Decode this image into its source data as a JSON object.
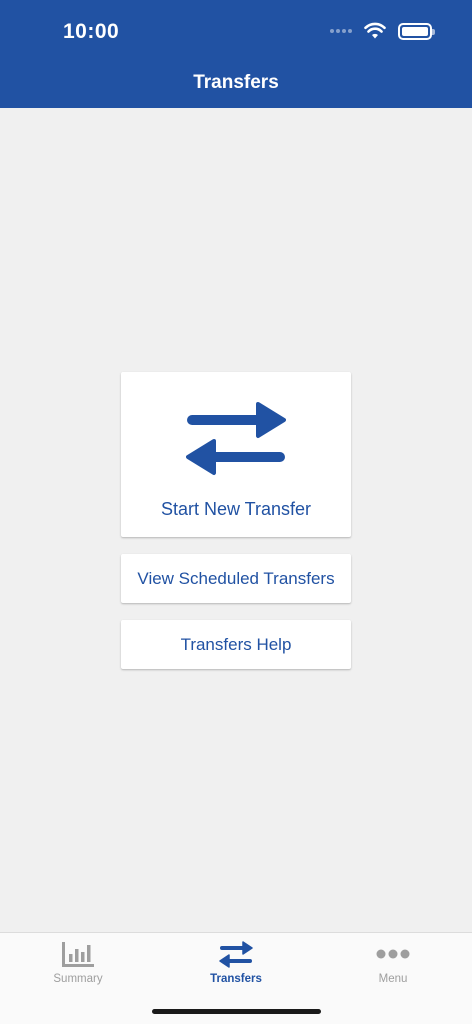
{
  "status_bar": {
    "time": "10:00"
  },
  "header": {
    "title": "Transfers"
  },
  "main": {
    "start_new_transfer": "Start New Transfer",
    "view_scheduled_transfers": "View Scheduled Transfers",
    "transfers_help": "Transfers Help"
  },
  "tabbar": {
    "tabs": [
      {
        "label": "Summary",
        "icon": "bar-chart-icon",
        "active": false
      },
      {
        "label": "Transfers",
        "icon": "transfer-arrows-icon",
        "active": true
      },
      {
        "label": "Menu",
        "icon": "more-dots-icon",
        "active": false
      }
    ]
  },
  "colors": {
    "brand": "#2152a3",
    "background": "#f0f0f0",
    "inactive": "#9e9e9e"
  }
}
